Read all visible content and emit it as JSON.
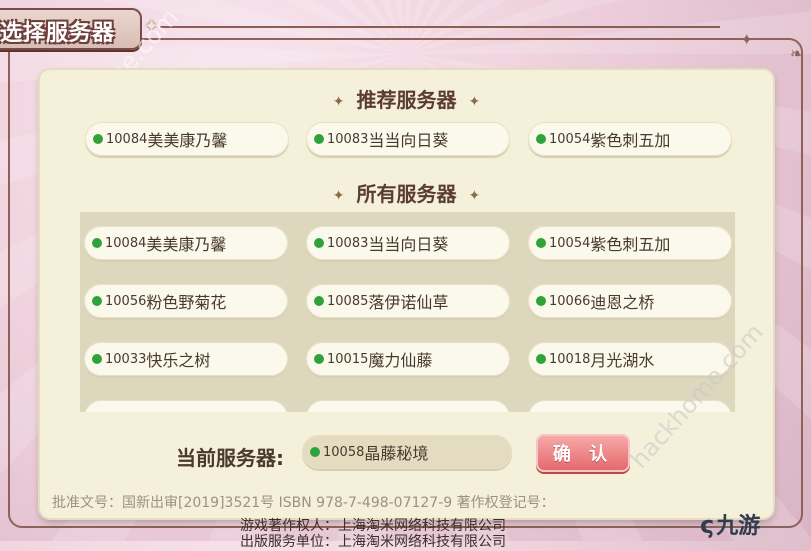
{
  "window": {
    "title": "选择服务器"
  },
  "recommended": {
    "heading": "推荐服务器",
    "servers": [
      {
        "id": "10084",
        "name": "美美康乃馨"
      },
      {
        "id": "10083",
        "name": "当当向日葵"
      },
      {
        "id": "10054",
        "name": "紫色刺五加"
      }
    ]
  },
  "all": {
    "heading": "所有服务器",
    "servers": [
      {
        "id": "10084",
        "name": "美美康乃馨"
      },
      {
        "id": "10083",
        "name": "当当向日葵"
      },
      {
        "id": "10054",
        "name": "紫色刺五加"
      },
      {
        "id": "10056",
        "name": "粉色野菊花"
      },
      {
        "id": "10085",
        "name": "落伊诺仙草"
      },
      {
        "id": "10066",
        "name": "迪恩之桥"
      },
      {
        "id": "10033",
        "name": "快乐之树"
      },
      {
        "id": "10015",
        "name": "魔力仙藤"
      },
      {
        "id": "10018",
        "name": "月光湖水"
      }
    ]
  },
  "current": {
    "label": "当前服务器:",
    "id": "10058",
    "name": "晶藤秘境"
  },
  "confirm_label": "确 认",
  "footer": {
    "line1": "批准文号：国新出审[2019]3521号  ISBN 978-7-498-07127-9  著作权登记号：",
    "line2": "游戏著作权人：上海淘米网络科技有限公司",
    "line3": "出版服务单位：上海淘米网络科技有限公司"
  },
  "watermarks": [
    "hackhome.com",
    "hackhome.com"
  ],
  "logo": {
    "text": "九游"
  },
  "colors": {
    "online_dot": "#2fa33a",
    "confirm": "#e46a6c",
    "panel": "#f5f0da"
  }
}
